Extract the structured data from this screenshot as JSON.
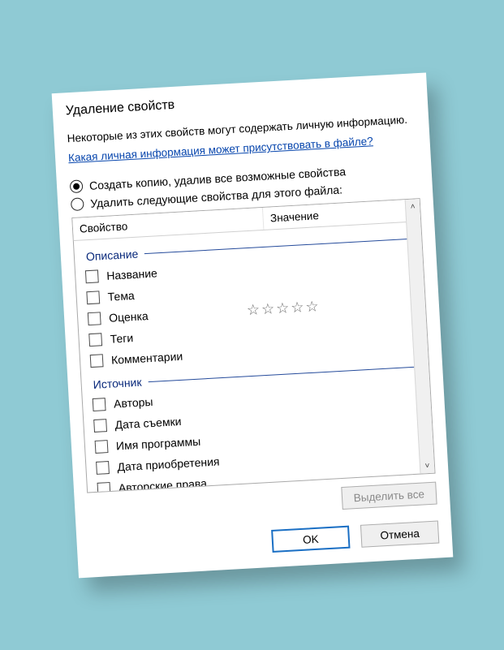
{
  "title": "Удаление свойств",
  "intro": "Некоторые из этих свойств могут содержать личную информацию.",
  "help_link": "Какая личная информация может присутствовать в файле?",
  "radios": {
    "create_copy": "Создать копию, удалив все возможные свойства",
    "remove_selected": "Удалить следующие свойства для этого файла:",
    "selected": "create_copy"
  },
  "columns": {
    "property": "Свойство",
    "value": "Значение"
  },
  "groups": [
    {
      "label": "Описание",
      "props": [
        {
          "name": "Название",
          "value": ""
        },
        {
          "name": "Тема",
          "value": ""
        },
        {
          "name": "Оценка",
          "value": "☆☆☆☆☆",
          "is_stars": true
        },
        {
          "name": "Теги",
          "value": ""
        },
        {
          "name": "Комментарии",
          "value": ""
        }
      ]
    },
    {
      "label": "Источник",
      "props": [
        {
          "name": "Авторы",
          "value": ""
        },
        {
          "name": "Дата съемки",
          "value": ""
        },
        {
          "name": "Имя программы",
          "value": ""
        },
        {
          "name": "Дата приобретения",
          "value": ""
        },
        {
          "name": "Авторские права",
          "value": ""
        }
      ]
    }
  ],
  "buttons": {
    "select_all": "Выделить все",
    "ok": "OK",
    "cancel": "Отмена"
  },
  "scroll": {
    "up": "˄",
    "down": "˅"
  }
}
